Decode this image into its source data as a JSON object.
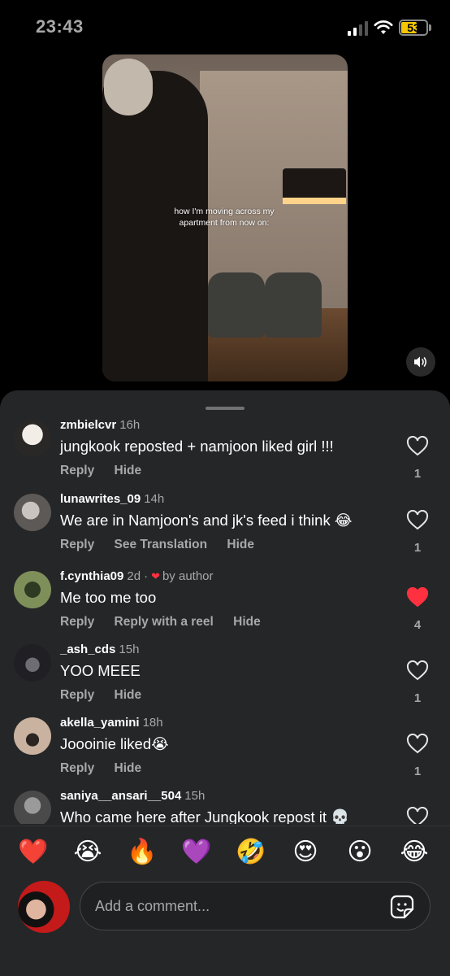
{
  "status_bar": {
    "time": "23:43",
    "battery": "53",
    "battery_color": "#f7c600"
  },
  "video": {
    "caption": "how I'm moving across my apartment from now on:",
    "mute_icon": "speaker-icon"
  },
  "comments": [
    {
      "username": "zmbielcvr",
      "time": "16h",
      "text": "jungkook reposted + namjoon liked girl !!!",
      "actions": [
        "Reply",
        "Hide"
      ],
      "likes": "1",
      "liked": false,
      "avatar_color": "#d8d1c7"
    },
    {
      "username": "lunawrites_09",
      "time": "14h",
      "text": "We are in Namjoon's and jk's feed i think 😂",
      "actions": [
        "Reply",
        "See Translation",
        "Hide"
      ],
      "likes": "1",
      "liked": false,
      "avatar_color": "#8e8a86"
    },
    {
      "username": "f.cynthia09",
      "time": "2d",
      "author_badge": "by author",
      "text": "Me too me too",
      "actions": [
        "Reply",
        "Reply with a reel",
        "Hide"
      ],
      "likes": "4",
      "liked": true,
      "avatar_color": "#6d7d4f"
    },
    {
      "username": "_ash_cds",
      "time": "15h",
      "text": "YOO MEEE",
      "actions": [
        "Reply",
        "Hide"
      ],
      "likes": "1",
      "liked": false,
      "avatar_color": "#3c3b40"
    },
    {
      "username": "akella_yamini",
      "time": "18h",
      "text": "Joooinie liked😭",
      "actions": [
        "Reply",
        "Hide"
      ],
      "likes": "1",
      "liked": false,
      "avatar_color": "#b59b86"
    },
    {
      "username": "saniya__ansari__504",
      "time": "15h",
      "text": "Who came here after Jungkook repost it 💀",
      "actions": [],
      "likes": "",
      "liked": false,
      "avatar_color": "#5a5a5a"
    }
  ],
  "emoji_bar": [
    "❤️",
    "😭",
    "🔥",
    "💜",
    "🤣",
    "😍",
    "😮",
    "😂"
  ],
  "composer": {
    "placeholder": "Add a comment...",
    "sticker_icon": "sticker-icon"
  },
  "colors": {
    "sheet_bg": "#252628",
    "like_red": "#ff3040",
    "muted_text": "#a8a8a8"
  }
}
